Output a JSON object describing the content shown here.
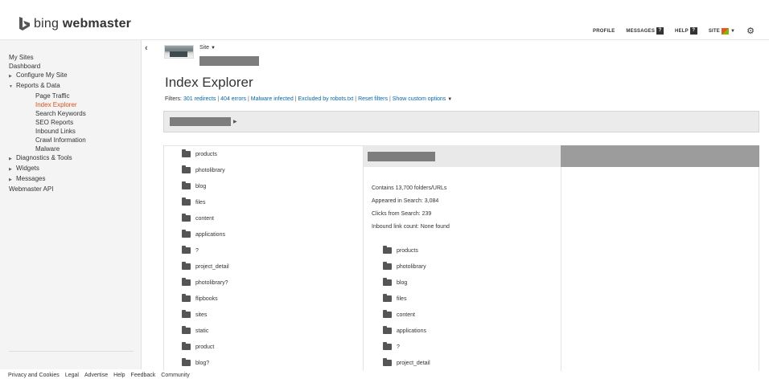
{
  "header": {
    "logo_text_light": "bing",
    "logo_text_bold": "webmaster",
    "nav": {
      "profile": "PROFILE",
      "messages": "MESSAGES",
      "messages_badge": "?",
      "help": "HELP",
      "help_badge": "?",
      "site": "SITE"
    },
    "settings_icon": "gear-icon"
  },
  "sidebar": {
    "collapse_glyph": "‹",
    "items": [
      {
        "label": "My Sites"
      },
      {
        "label": "Dashboard"
      },
      {
        "label": "Configure My Site"
      },
      {
        "label": "Reports & Data"
      },
      {
        "label": "Page Traffic"
      },
      {
        "label": "Index Explorer"
      },
      {
        "label": "Search Keywords"
      },
      {
        "label": "SEO Reports"
      },
      {
        "label": "Inbound Links"
      },
      {
        "label": "Crawl Information"
      },
      {
        "label": "Malware"
      },
      {
        "label": "Diagnostics & Tools"
      },
      {
        "label": "Widgets"
      },
      {
        "label": "Messages"
      },
      {
        "label": "Webmaster API"
      }
    ]
  },
  "site": {
    "selector_label": "Site"
  },
  "main": {
    "title": "Index Explorer",
    "filters_label": "Filters:",
    "filters": [
      "301 redirects",
      "404 errors",
      "Malware infected",
      "Excluded by robots.txt",
      "Reset filters",
      "Show custom options"
    ]
  },
  "column1": {
    "folders": [
      "products",
      "photolibrary",
      "blog",
      "files",
      "content",
      "applications",
      "?",
      "project_detail",
      "photolibrary?",
      "flipbooks",
      "sites",
      "static",
      "product",
      "blog?"
    ]
  },
  "column2": {
    "stats": [
      "Contains 13,700 folders/URLs",
      "Appeared in Search: 3,084",
      "Clicks from Search: 239",
      "Inbound link count: None found"
    ],
    "folders": [
      "products",
      "photolibrary",
      "blog",
      "files",
      "content",
      "applications",
      "?",
      "project_detail"
    ]
  },
  "footer": {
    "links": [
      "Privacy and Cookies",
      "Legal",
      "Advertise",
      "Help",
      "Feedback",
      "Community"
    ]
  },
  "colors": {
    "accent_active": "#e1501b",
    "link": "#0067b8",
    "sidebar_bg": "#f4f4f4"
  }
}
